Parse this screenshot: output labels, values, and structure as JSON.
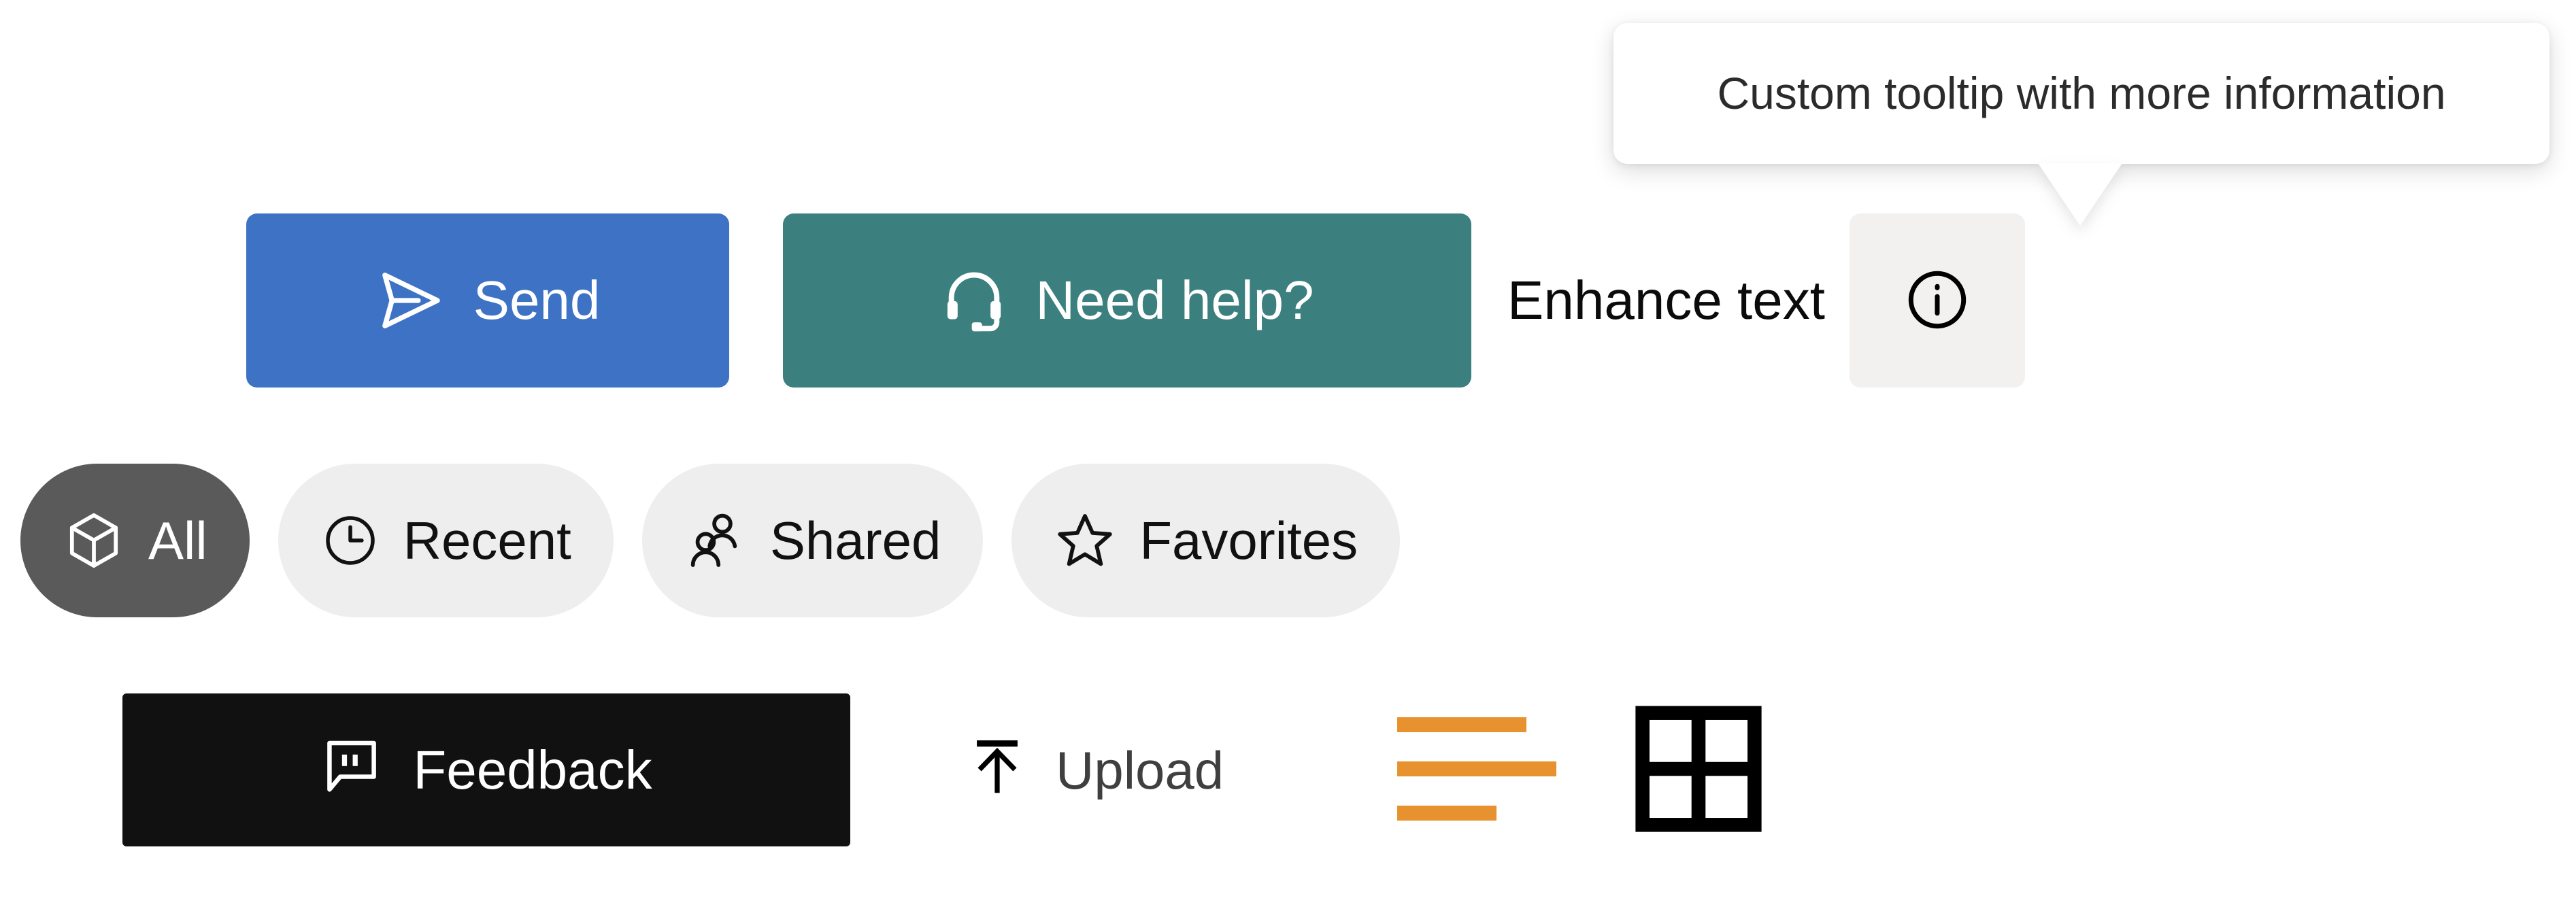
{
  "tooltip": {
    "text": "Custom tooltip with more information",
    "background": "#ffffff",
    "text_color": "#2b2b2b"
  },
  "actions": {
    "send": {
      "label": "Send",
      "icon": "send-icon",
      "background": "#3D72C4",
      "text_color": "#ffffff"
    },
    "help": {
      "label": "Need help?",
      "icon": "headset-icon",
      "background": "#3B7F7F",
      "text_color": "#ffffff"
    },
    "enhance_text": {
      "label": "Enhance text",
      "text_color": "#0b0b0b"
    },
    "info": {
      "icon": "info-circle-icon",
      "background": "#F2F1F0",
      "icon_color": "#000000"
    }
  },
  "filters": {
    "items": [
      {
        "label": "All",
        "icon": "cube-icon",
        "selected": true,
        "background": "#5A5A5A",
        "text_color": "#ffffff"
      },
      {
        "label": "Recent",
        "icon": "clock-icon",
        "selected": false,
        "background": "#EFEEEE",
        "text_color": "#111111"
      },
      {
        "label": "Shared",
        "icon": "people-icon",
        "selected": false,
        "background": "#EFEEEE",
        "text_color": "#111111"
      },
      {
        "label": "Favorites",
        "icon": "star-icon",
        "selected": false,
        "background": "#EFEEEE",
        "text_color": "#111111"
      }
    ]
  },
  "bottom": {
    "feedback": {
      "label": "Feedback",
      "icon": "comment-quote-icon",
      "background": "#111111",
      "text_color": "#ffffff"
    },
    "upload": {
      "label": "Upload",
      "icon": "arrow-up-to-line-icon",
      "text_color": "#3f3f3f",
      "icon_color": "#000000"
    },
    "list_view": {
      "icon": "list-lines-icon",
      "color": "#E8922F"
    },
    "grid_view": {
      "icon": "grid-2x2-icon",
      "color": "#000000"
    }
  }
}
